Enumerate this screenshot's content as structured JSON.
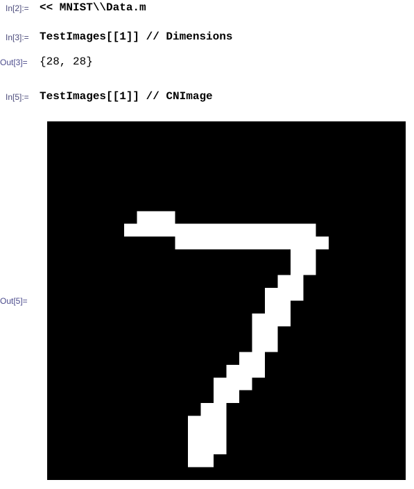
{
  "cells": [
    {
      "label": "In[2]:=",
      "input": "<< MNIST\\\\Data.m"
    },
    {
      "label": "In[3]:=",
      "input": "TestImages[[1]] // Dimensions"
    },
    {
      "label": "Out[3]=",
      "output": "{28, 28}"
    },
    {
      "label": "In[5]:=",
      "input": "TestImages[[1]] // CNImage"
    },
    {
      "label": "Out[5]="
    }
  ],
  "image": {
    "size": 28,
    "background": "#000000",
    "foreground": "#ffffff",
    "white_runs": [
      [
        7,
        7,
        9
      ],
      [
        8,
        6,
        20
      ],
      [
        9,
        10,
        21
      ],
      [
        10,
        19,
        20
      ],
      [
        11,
        19,
        20
      ],
      [
        12,
        18,
        19
      ],
      [
        13,
        17,
        19
      ],
      [
        14,
        17,
        18
      ],
      [
        15,
        16,
        18
      ],
      [
        16,
        16,
        17
      ],
      [
        17,
        16,
        17
      ],
      [
        18,
        15,
        16
      ],
      [
        19,
        14,
        16
      ],
      [
        20,
        13,
        15
      ],
      [
        21,
        13,
        14
      ],
      [
        22,
        12,
        13
      ],
      [
        23,
        11,
        13
      ],
      [
        24,
        11,
        13
      ],
      [
        25,
        11,
        13
      ],
      [
        26,
        11,
        12
      ]
    ]
  }
}
